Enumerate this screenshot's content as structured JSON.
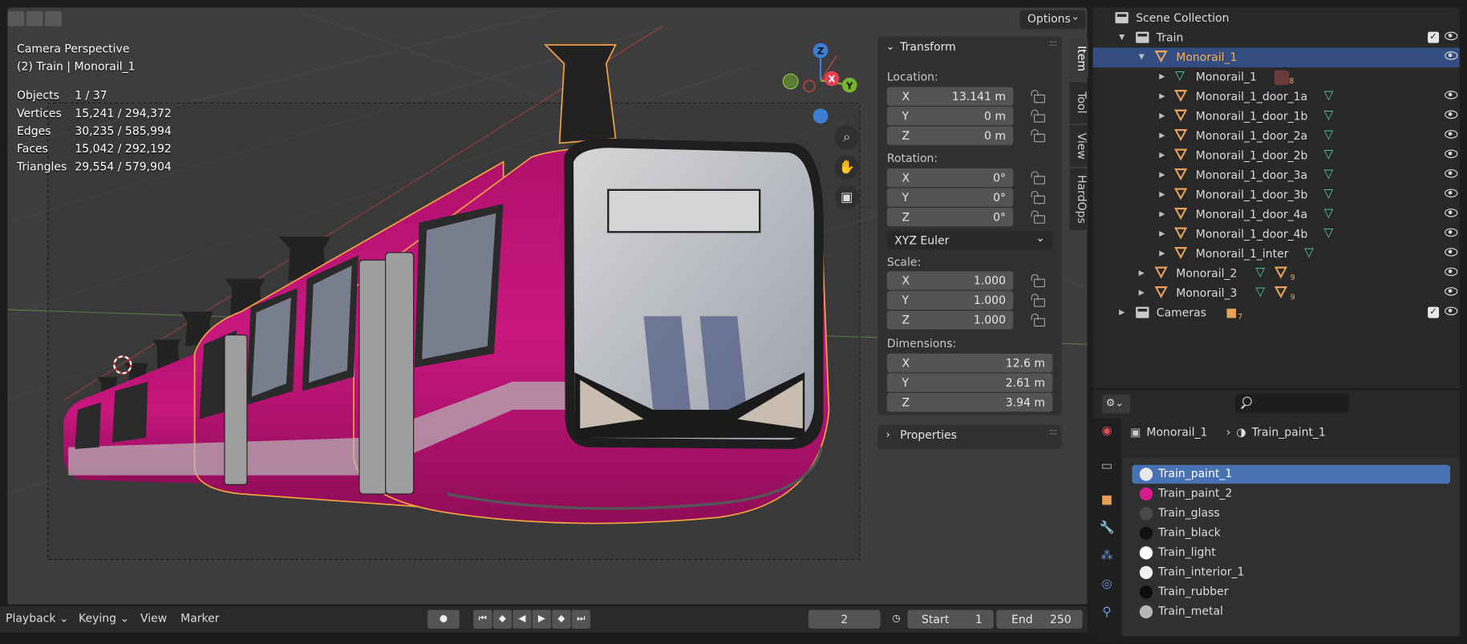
{
  "viewport": {
    "options_label": "Options",
    "title": "Camera Perspective",
    "context": "(2) Train | Monorail_1",
    "stats": [
      {
        "label": "Objects",
        "value": "1 / 37"
      },
      {
        "label": "Vertices",
        "value": "15,241 / 294,372"
      },
      {
        "label": "Edges",
        "value": "30,235 / 585,994"
      },
      {
        "label": "Faces",
        "value": "15,042 / 292,192"
      },
      {
        "label": "Triangles",
        "value": "29,554 / 579,904"
      }
    ],
    "gizmo": {
      "z": "Z",
      "x": "X",
      "y": "Y"
    },
    "colors": {
      "train_body": "#c2157a",
      "selection_outline": "#f0a040"
    }
  },
  "npanel": {
    "transform_title": "Transform",
    "location_label": "Location:",
    "location": [
      {
        "axis": "X",
        "value": "13.141 m"
      },
      {
        "axis": "Y",
        "value": "0 m"
      },
      {
        "axis": "Z",
        "value": "0 m"
      }
    ],
    "rotation_label": "Rotation:",
    "rotation": [
      {
        "axis": "X",
        "value": "0°"
      },
      {
        "axis": "Y",
        "value": "0°"
      },
      {
        "axis": "Z",
        "value": "0°"
      }
    ],
    "rotation_mode": "XYZ Euler",
    "scale_label": "Scale:",
    "scale": [
      {
        "axis": "X",
        "value": "1.000"
      },
      {
        "axis": "Y",
        "value": "1.000"
      },
      {
        "axis": "Z",
        "value": "1.000"
      }
    ],
    "dimensions_label": "Dimensions:",
    "dimensions": [
      {
        "axis": "X",
        "value": "12.6 m"
      },
      {
        "axis": "Y",
        "value": "2.61 m"
      },
      {
        "axis": "Z",
        "value": "3.94 m"
      }
    ],
    "properties_title": "Properties",
    "tabs": [
      "Item",
      "Tool",
      "View",
      "HardOps"
    ]
  },
  "timeline": {
    "playback": "Playback",
    "keying": "Keying",
    "view": "View",
    "marker": "Marker",
    "current_frame": "2",
    "start_label": "Start",
    "start_value": "1",
    "end_label": "End",
    "end_value": "250"
  },
  "outliner": {
    "scene_collection": "Scene Collection",
    "train": "Train",
    "monorail_1": "Monorail_1",
    "mesh_data": "Monorail_1",
    "mesh_badge": "8",
    "children": [
      "Monorail_1_door_1a",
      "Monorail_1_door_1b",
      "Monorail_1_door_2a",
      "Monorail_1_door_2b",
      "Monorail_1_door_3a",
      "Monorail_1_door_3b",
      "Monorail_1_door_4a",
      "Monorail_1_door_4b",
      "Monorail_1_inter"
    ],
    "monorail_2": "Monorail_2",
    "monorail_2_badge": "9",
    "monorail_3": "Monorail_3",
    "monorail_3_badge": "9",
    "cameras": "Cameras",
    "cameras_badge": "7"
  },
  "properties": {
    "breadcrumb_object": "Monorail_1",
    "breadcrumb_material": "Train_paint_1",
    "materials": [
      {
        "name": "Train_paint_1",
        "color": "#e8e8e8"
      },
      {
        "name": "Train_paint_2",
        "color": "#d81b8a"
      },
      {
        "name": "Train_glass",
        "color": "#4a4a4a"
      },
      {
        "name": "Train_black",
        "color": "#111111"
      },
      {
        "name": "Train_light",
        "color": "#ffffff"
      },
      {
        "name": "Train_interior_1",
        "color": "#f0f0f0"
      },
      {
        "name": "Train_rubber",
        "color": "#0c0c0c"
      },
      {
        "name": "Train_metal",
        "color": "#b8b8b8"
      }
    ]
  }
}
